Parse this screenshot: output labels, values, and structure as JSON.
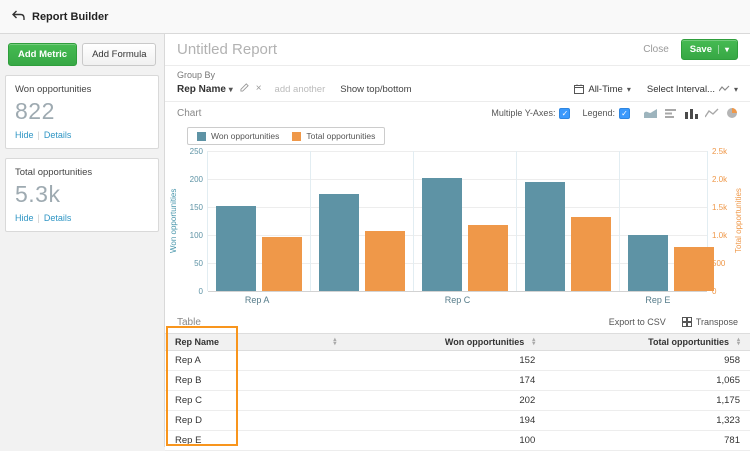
{
  "topbar": {
    "title": "Report Builder"
  },
  "sidebar": {
    "add_metric_label": "Add Metric",
    "add_formula_label": "Add Formula",
    "metrics": [
      {
        "title": "Won opportunities",
        "value": "822",
        "hide_label": "Hide",
        "details_label": "Details"
      },
      {
        "title": "Total opportunities",
        "value": "5.3k",
        "hide_label": "Hide",
        "details_label": "Details"
      }
    ]
  },
  "header": {
    "title": "Untitled Report",
    "close_label": "Close",
    "save_label": "Save"
  },
  "groupby": {
    "label": "Group By",
    "selected": "Rep Name",
    "add_another_label": "add another",
    "show_top_bottom_label": "Show top/bottom",
    "time_range": "All-Time",
    "interval_placeholder": "Select Interval..."
  },
  "chart_section": {
    "title": "Chart",
    "multiple_y_axes_label": "Multiple Y-Axes:",
    "legend_label": "Legend:"
  },
  "chart_data": {
    "type": "bar",
    "categories": [
      "Rep A",
      "Rep B",
      "Rep C",
      "Rep D",
      "Rep E"
    ],
    "x_tick_labels": [
      "Rep A",
      "",
      "Rep C",
      "",
      "Rep E"
    ],
    "series": [
      {
        "name": "Won opportunities",
        "color": "#5e93a5",
        "axis": "left",
        "values": [
          152,
          174,
          202,
          194,
          100
        ]
      },
      {
        "name": "Total opportunities",
        "color": "#ef9849",
        "axis": "right",
        "values": [
          958,
          1065,
          1175,
          1323,
          781
        ]
      }
    ],
    "left_axis": {
      "label": "Won opportunities",
      "min": 0,
      "max": 250,
      "ticks": [
        "0",
        "50",
        "100",
        "150",
        "200",
        "250"
      ]
    },
    "right_axis": {
      "label": "Total opportunities",
      "min": 0,
      "max": 2500,
      "ticks": [
        "0",
        "500",
        "1.0k",
        "1.5k",
        "2.0k",
        "2.5k"
      ]
    },
    "legend_position": "top-left",
    "grid": true
  },
  "table_section": {
    "title": "Table",
    "export_label": "Export to CSV",
    "transpose_label": "Transpose",
    "columns": [
      "Rep Name",
      "Won opportunities",
      "Total opportunities"
    ],
    "rows": [
      [
        "Rep A",
        "152",
        "958"
      ],
      [
        "Rep B",
        "174",
        "1,065"
      ],
      [
        "Rep C",
        "202",
        "1,175"
      ],
      [
        "Rep D",
        "194",
        "1,323"
      ],
      [
        "Rep E",
        "100",
        "781"
      ]
    ]
  },
  "colors": {
    "won": "#5e93a5",
    "total": "#ef9849",
    "green_button": "#3cb54a",
    "annotation_highlight": "#f8951d",
    "link": "#2e95c4",
    "checkbox": "#3b99fc"
  }
}
